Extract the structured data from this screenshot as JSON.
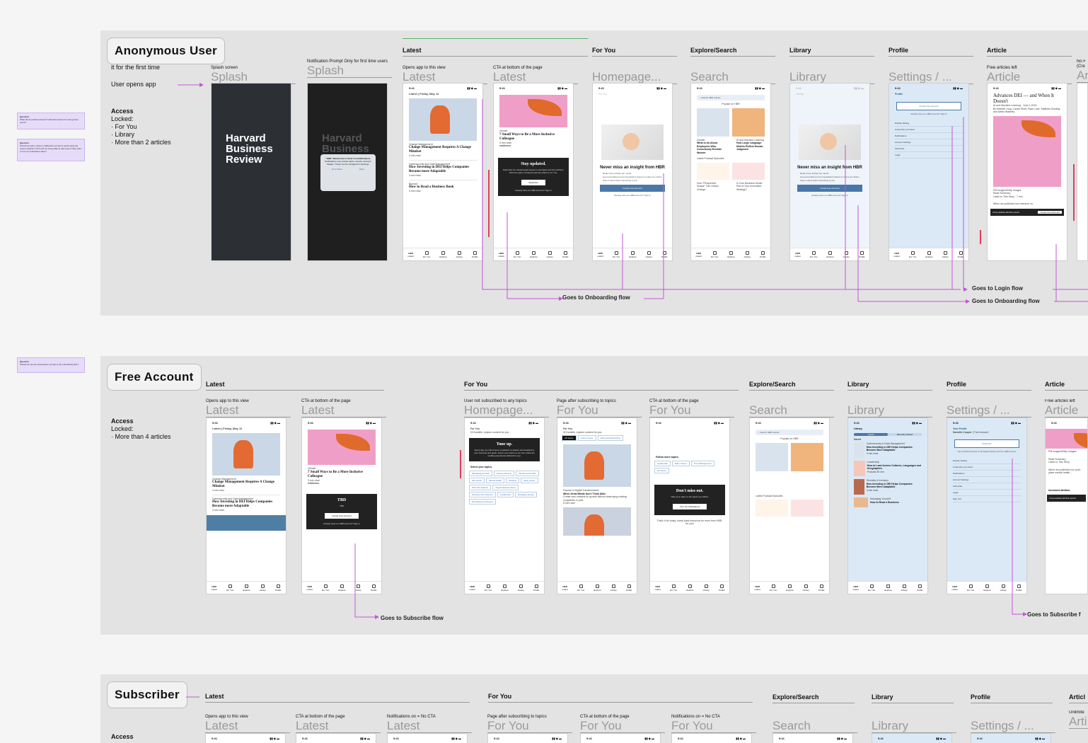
{
  "sticky_notes": [
    {
      "label": "Question",
      "text": "What about podcast access? Unlimited access for anonymous users?"
    },
    {
      "label": "Question",
      "text": "Should we ask a custom notification prompt to avoid using the system default in iOS and not being able to ask users if they want to turn on notifications later?"
    },
    {
      "label": "Question",
      "text": "Should we put the subscription prompt in the onboarding flow?"
    }
  ],
  "status_time": "9:41",
  "tabs": [
    "Latest",
    "For You",
    "Explore",
    "Library",
    "Profile"
  ],
  "brand": "HBR",
  "anon": {
    "title": "Anonymous User",
    "first_time": "it for the first time",
    "opens_app": "User opens app",
    "access": "Access",
    "locked": "Locked:",
    "locked_items": [
      "For You",
      "Library",
      "More than 2 articles"
    ],
    "sections": {
      "latest": "Latest",
      "foryou": "For You",
      "explore": "Explore/Search",
      "library": "Library",
      "profile": "Profile",
      "article": "Article"
    },
    "frames": [
      {
        "small": "Splash screen",
        "big": "Splash"
      },
      {
        "small": "Notification Prompt Only for first time users",
        "big": "Splash"
      },
      {
        "small": "Opens app to this view",
        "big": "Latest"
      },
      {
        "small": "CTA at bottom of the page",
        "big": "Latest"
      },
      {
        "small": "",
        "big": "Homepage..."
      },
      {
        "small": "",
        "big": "Search"
      },
      {
        "small": "",
        "big": "Library"
      },
      {
        "small": "",
        "big": "Settings / ..."
      },
      {
        "small": "Free articles left",
        "big": "Article"
      },
      {
        "small": "No F (Cre",
        "big": "Ar"
      }
    ],
    "splash_logo": [
      "Harvard",
      "Business",
      "Review"
    ],
    "notif": {
      "title": "\"HBR\" Would Like to Send You Notifications",
      "body": "Notifications may include alerts, sounds, and icon badges. These can be configured in Settings.",
      "deny": "Don't Allow",
      "allow": "Allow"
    },
    "latest_header": "Latest",
    "latest_date": "Friday, May 12",
    "kicker1": "Change Management",
    "headline1": "Change Management Requires A Change Mindset",
    "read1": "2 min read",
    "kicker2": "Cybersecurity and Data Management",
    "headline2": "How Investing in DEI Helps Companies Become more Adaptable",
    "read2": "3 min read",
    "kicker3": "Burnout",
    "headline3": "How to Read a Business Book",
    "read3": "3 min read",
    "cta_kicker": "Gender",
    "cta_headline": "7 Small Ways to Be a More Inclusive Colleague",
    "cta_read": "3 min read",
    "cta_sponsor": "resilience",
    "card_title": "Stay updated.",
    "card_body": "Subscribe for uninterrupted access to the latest and the archives. Pick the topics of interest and see what's in for You.",
    "card_button": "Subscribe",
    "card_signin": "Already have an HBR account? Sign in",
    "foryou_header": "For You",
    "never_miss": "Never miss an insight from HBR",
    "bullets": [
      "Read 3 free articles per month",
      "Get personalized recommendations based on topics you follow",
      "Save content that's interesting to you"
    ],
    "create_account": "Create Free Account",
    "already": "Already have an HBR account? Sign in",
    "search_placeholder": "Search HBR articles",
    "popular": "Popular on HBR",
    "search_k1": "Gender",
    "search_h1": "What to do About Employees Who Consciously Exclude Women",
    "search_k2": "AI and Machine Learning",
    "search_h2": "How Large Language Models Reflect Human Judgment",
    "podcasts": "Latest Podcast Episodes",
    "pod1": "How \"Perspective Swaps\" Can Unlock Change",
    "pod2": "Is Your Business Model Part of Your Innovation Strategy?",
    "library_header": "Library",
    "profile_header": "Profile",
    "profile_menu": [
      "Display Setting",
      "Customize your feed",
      "Notifications",
      "Account Settings",
      "Subscribe",
      "Legal"
    ],
    "article_title": "Advances DEI — and When It Doesn't",
    "article_byline": "AI and Machine Learning · June 1 2023",
    "article_authors": "By Mitchell Tung, Louise Shott, Ryan Luke, Matthew Dowling and Alexis Wakeley",
    "article_credit": "PM Images/Getty Images",
    "article_actions": [
      "Read Summary",
      "Listen to This Story · 7 min"
    ],
    "article_body": "When we published our research on",
    "article_banner": "2 free articles left this month",
    "article_cta": "Create Free Account",
    "goes_onboarding": "Goes to Onboarding flow",
    "goes_login": "Goes to Login flow",
    "goes_onboarding2": "Goes to Onboarding flow"
  },
  "free": {
    "title": "Free Account",
    "access": "Access",
    "locked": "Locked:",
    "locked_items": [
      "More than 4 articles"
    ],
    "sections": {
      "latest": "Latest",
      "foryou": "For You",
      "explore": "Explore/Search",
      "library": "Library",
      "profile": "Profile",
      "article": "Article"
    },
    "frames": [
      {
        "small": "Opens app to this view",
        "big": "Latest"
      },
      {
        "small": "CTA at bottom of the page",
        "big": "Latest"
      },
      {
        "small": "User not subscribed to any topics",
        "big": "Homepage..."
      },
      {
        "small": "Page after subscribing to topics",
        "big": "For You"
      },
      {
        "small": "CTA at bottom of the page",
        "big": "For You"
      },
      {
        "small": "",
        "big": "Search"
      },
      {
        "small": "",
        "big": "Library"
      },
      {
        "small": "",
        "big": "Settings / ..."
      },
      {
        "small": "Free articles left",
        "big": "Article"
      }
    ],
    "latest_header": "Latest",
    "latest_date": "Friday, May 12",
    "kicker1": "Change Management",
    "headline1": "Change Management Requires A Change Mindset",
    "read1": "3 min read",
    "kicker2": "Cybersecurity and Data Management",
    "headline2": "How Investing in DEI Helps Companies Become more Adaptable",
    "read2": "3 min read",
    "cta_kicker": "Gender",
    "cta_headline": "7 Small Ways to Be a More Inclusive Colleague",
    "cta_read": "3 min read",
    "cta_sponsor": "resilience",
    "tbd_title": "TBD",
    "tbd_body": "TBD",
    "tbd_button": "Create Free Account",
    "tbd_signin": "Already have an HBR account? Sign in",
    "foryou_header": "For You",
    "foryou_greet": "Hi Danielle, explore content for you",
    "tuneup_title": "Tune up.",
    "tuneup_body": "Every day you will receive a selection of articles personalized to your interests and goals. Select your topics so we can create the reading experience tailored for you.",
    "select_topics": "Select your topics.",
    "topics": [
      "Managing yourself",
      "Career planning",
      "Interpersonal skills",
      "HR search",
      "Mental health",
      "Strategy",
      "Early career",
      "Work-life balance",
      "Organizational culture",
      "Diversity and inclusion",
      "Leadership",
      "Managing people",
      "Developing employees"
    ],
    "chips": [
      "All Topics",
      "Current Issue",
      "Hiring and Recruiting"
    ],
    "fy_kicker": "Popular in Digital Transformation",
    "fy_headline": "When Great Minds Don't Think Alike",
    "fy_body": "Create new markets for growth without destroying existing companies or jobs",
    "fy_read": "8 min read",
    "follow_more": "Follow more topics",
    "follow_topics": [
      "Leadership",
      "Early Career",
      "Time Management",
      "All Topics"
    ],
    "dont_miss_title": "Don't miss out.",
    "dont_miss_body": "Stay up to date on the topics you follow.",
    "dont_miss_button": "Turn On Notifications",
    "thats_it": "That's it for today, check back tomorrow for more from HBR- for you!",
    "search_placeholder": "Search HBR articles",
    "popular": "Popular on HBR",
    "podcasts": "Latest Podcast Episodes",
    "library_header": "Library",
    "library_tabs": [
      "Saved",
      "Recently Viewed"
    ],
    "saved": "Saved",
    "lib_items": [
      {
        "k": "Cybersecurity & Data Management",
        "h": "How Investing in DEI Helps Companies Become More Adaptable",
        "r": "3 min read"
      },
      {
        "k": "Leadership",
        "h": "How to Lead Across Cultures, Languages and Geographies",
        "r": "Podcast 35 min"
      },
      {
        "k": "Diversity & Inclusion",
        "h": "How Investing in DEI Helps Companies Become More Adaptable",
        "r": "3 min read"
      },
      {
        "k": "Managing Yourself",
        "h": "How to Read a Business",
        "r": ""
      }
    ],
    "profile_title": "Your Profile",
    "profile_name": "Danielle Cooper",
    "profile_plan": "Free Account",
    "profile_subscribe": "Subscribe",
    "profile_unlimited": "Get unlimited access to all digital articles and the HBR archive",
    "profile_menu": [
      "Display Setting",
      "Customize your feed",
      "Notifications",
      "Account Settings",
      "Subscribe",
      "Legal",
      "Sign Out"
    ],
    "article_credit": "PM Images/Getty Images",
    "article_actions": [
      "Read Summary",
      "Listen to This Story"
    ],
    "article_body": "When we published our work-place mental health...",
    "article_increased": "Increased attrition.",
    "article_banner": "4 free articles left this month",
    "goes_subscribe": "Goes to Subscribe flow",
    "goes_subscribe2": "Goes to Subscribe f"
  },
  "sub": {
    "title": "Subscriber",
    "access": "Access",
    "sections": {
      "latest": "Latest",
      "foryou": "For You",
      "explore": "Explore/Search",
      "library": "Library",
      "profile": "Profile",
      "article": "Articl"
    },
    "frames": [
      {
        "small": "Opens app to this view",
        "big": "Latest"
      },
      {
        "small": "CTA at bottom of the page",
        "big": "Latest"
      },
      {
        "small": "Notifications on = No CTA",
        "big": "Latest"
      },
      {
        "small": "Page after subscribing to topics",
        "big": "For You"
      },
      {
        "small": "CTA at bottom of the page",
        "big": "For You"
      },
      {
        "small": "Notifications on = No CTA",
        "big": "For You"
      },
      {
        "small": "",
        "big": "Search"
      },
      {
        "small": "",
        "big": "Library"
      },
      {
        "small": "",
        "big": "Settings / ..."
      },
      {
        "small": "Unlimite",
        "big": "Arti"
      }
    ]
  }
}
